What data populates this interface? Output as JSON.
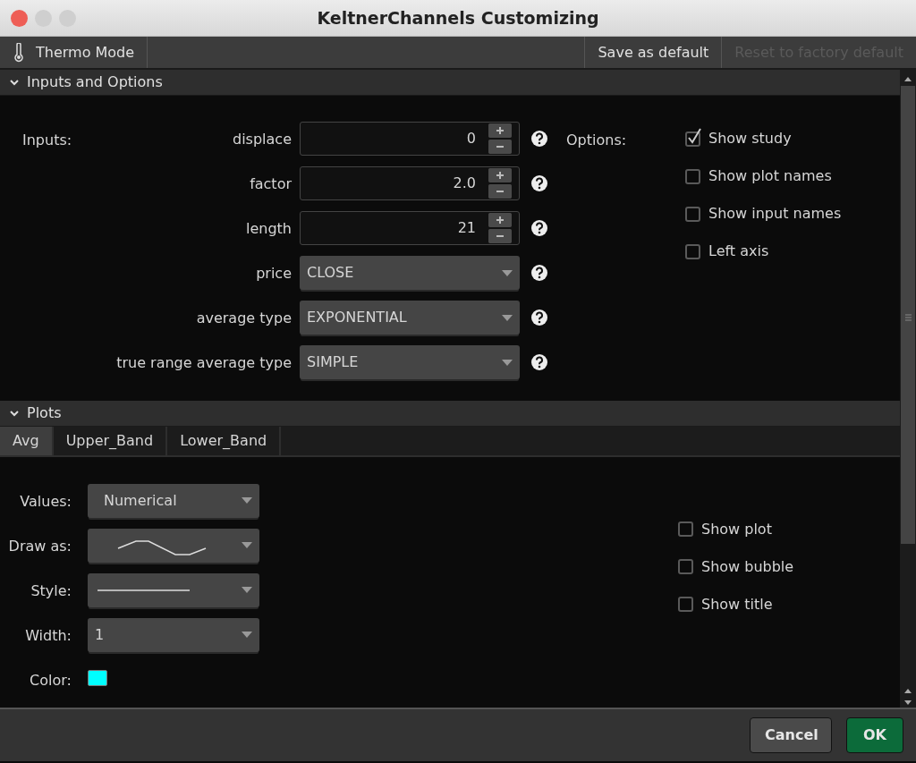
{
  "window": {
    "title": "KeltnerChannels Customizing"
  },
  "toolbar": {
    "thermo_mode": "Thermo Mode",
    "buttons": [
      {
        "label": "Save as default",
        "disabled": false
      },
      {
        "label": "Reset to factory default",
        "disabled": true
      }
    ]
  },
  "inputs_section": {
    "title": "Inputs and Options",
    "expanded": true,
    "inputs_label": "Inputs:",
    "options_label": "Options:",
    "inputs": [
      {
        "label": "displace",
        "kind": "spinner",
        "value": "0"
      },
      {
        "label": "factor",
        "kind": "spinner",
        "value": "2.0"
      },
      {
        "label": "length",
        "kind": "spinner",
        "value": "21"
      },
      {
        "label": "price",
        "kind": "dropdown",
        "value": "CLOSE"
      },
      {
        "label": "average type",
        "kind": "dropdown",
        "value": "EXPONENTIAL"
      },
      {
        "label": "true range average type",
        "kind": "dropdown",
        "value": "SIMPLE"
      }
    ],
    "options": [
      {
        "label": "Show study",
        "checked": true
      },
      {
        "label": "Show plot names",
        "checked": false
      },
      {
        "label": "Show input names",
        "checked": false
      },
      {
        "label": "Left axis",
        "checked": false
      }
    ]
  },
  "plots_section": {
    "title": "Plots",
    "expanded": true,
    "tabs": [
      {
        "label": "Avg",
        "selected": true
      },
      {
        "label": "Upper_Band",
        "selected": false
      },
      {
        "label": "Lower_Band",
        "selected": false
      }
    ],
    "settings": [
      {
        "label": "Values:",
        "kind": "text",
        "value": "Numerical"
      },
      {
        "label": "Draw as:",
        "kind": "line-shape"
      },
      {
        "label": "Style:",
        "kind": "line-style"
      },
      {
        "label": "Width:",
        "kind": "text",
        "value": "1"
      },
      {
        "label": "Color:",
        "kind": "color",
        "color": "#00ffff"
      }
    ],
    "options": [
      {
        "label": "Show plot",
        "checked": false
      },
      {
        "label": "Show bubble",
        "checked": false
      },
      {
        "label": "Show title",
        "checked": false
      }
    ]
  },
  "footer": {
    "buttons": [
      {
        "label": "Cancel",
        "kind": "secondary"
      },
      {
        "label": "OK",
        "kind": "primary"
      }
    ]
  }
}
